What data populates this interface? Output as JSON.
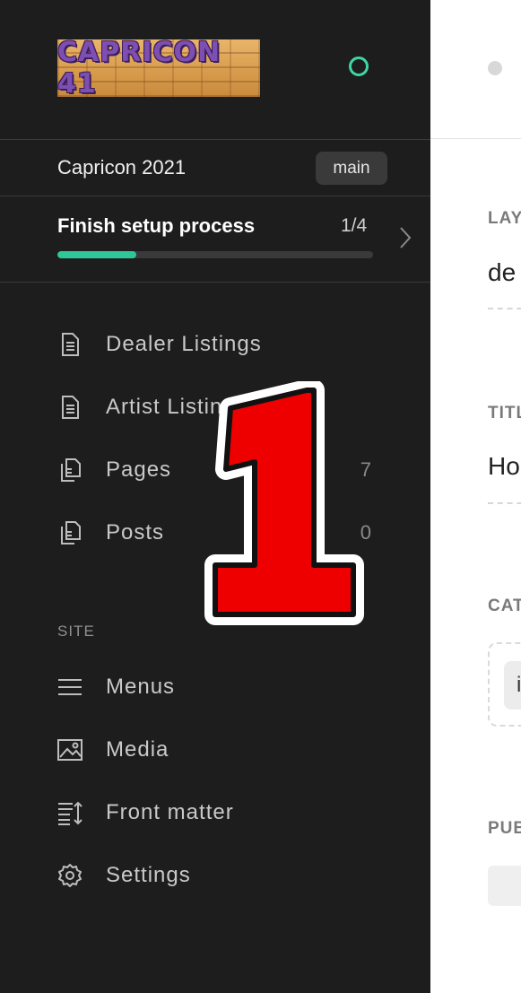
{
  "app": {
    "logo_text": "CAPRICON 41",
    "site_name": "Capricon 2021",
    "branch": "main",
    "accent": "#2fc79a",
    "status_ring_color": "#3fd6a3"
  },
  "setup": {
    "title": "Finish setup process",
    "count": "1/4",
    "progress": 0.25
  },
  "nav": {
    "items": [
      {
        "label": "Dealer Listings",
        "icon": "document-icon",
        "count": ""
      },
      {
        "label": "Artist Listings",
        "icon": "document-icon",
        "count": ""
      },
      {
        "label": "Pages",
        "icon": "documents-icon",
        "count": "7"
      },
      {
        "label": "Posts",
        "icon": "documents-icon",
        "count": "0"
      }
    ],
    "site_section": "SITE",
    "site_items": [
      {
        "label": "Menus",
        "icon": "menu-icon"
      },
      {
        "label": "Media",
        "icon": "image-icon"
      },
      {
        "label": "Front matter",
        "icon": "sort-lines-icon"
      },
      {
        "label": "Settings",
        "icon": "gear-icon"
      }
    ]
  },
  "overlay": {
    "number": "1",
    "color": "#ee0000"
  },
  "main": {
    "layout_label": "LAY",
    "layout_value": "de",
    "title_label": "TITL",
    "title_value": "Ho",
    "categories_label": "CAT",
    "category_chip": "i",
    "published_label": "PUB"
  }
}
